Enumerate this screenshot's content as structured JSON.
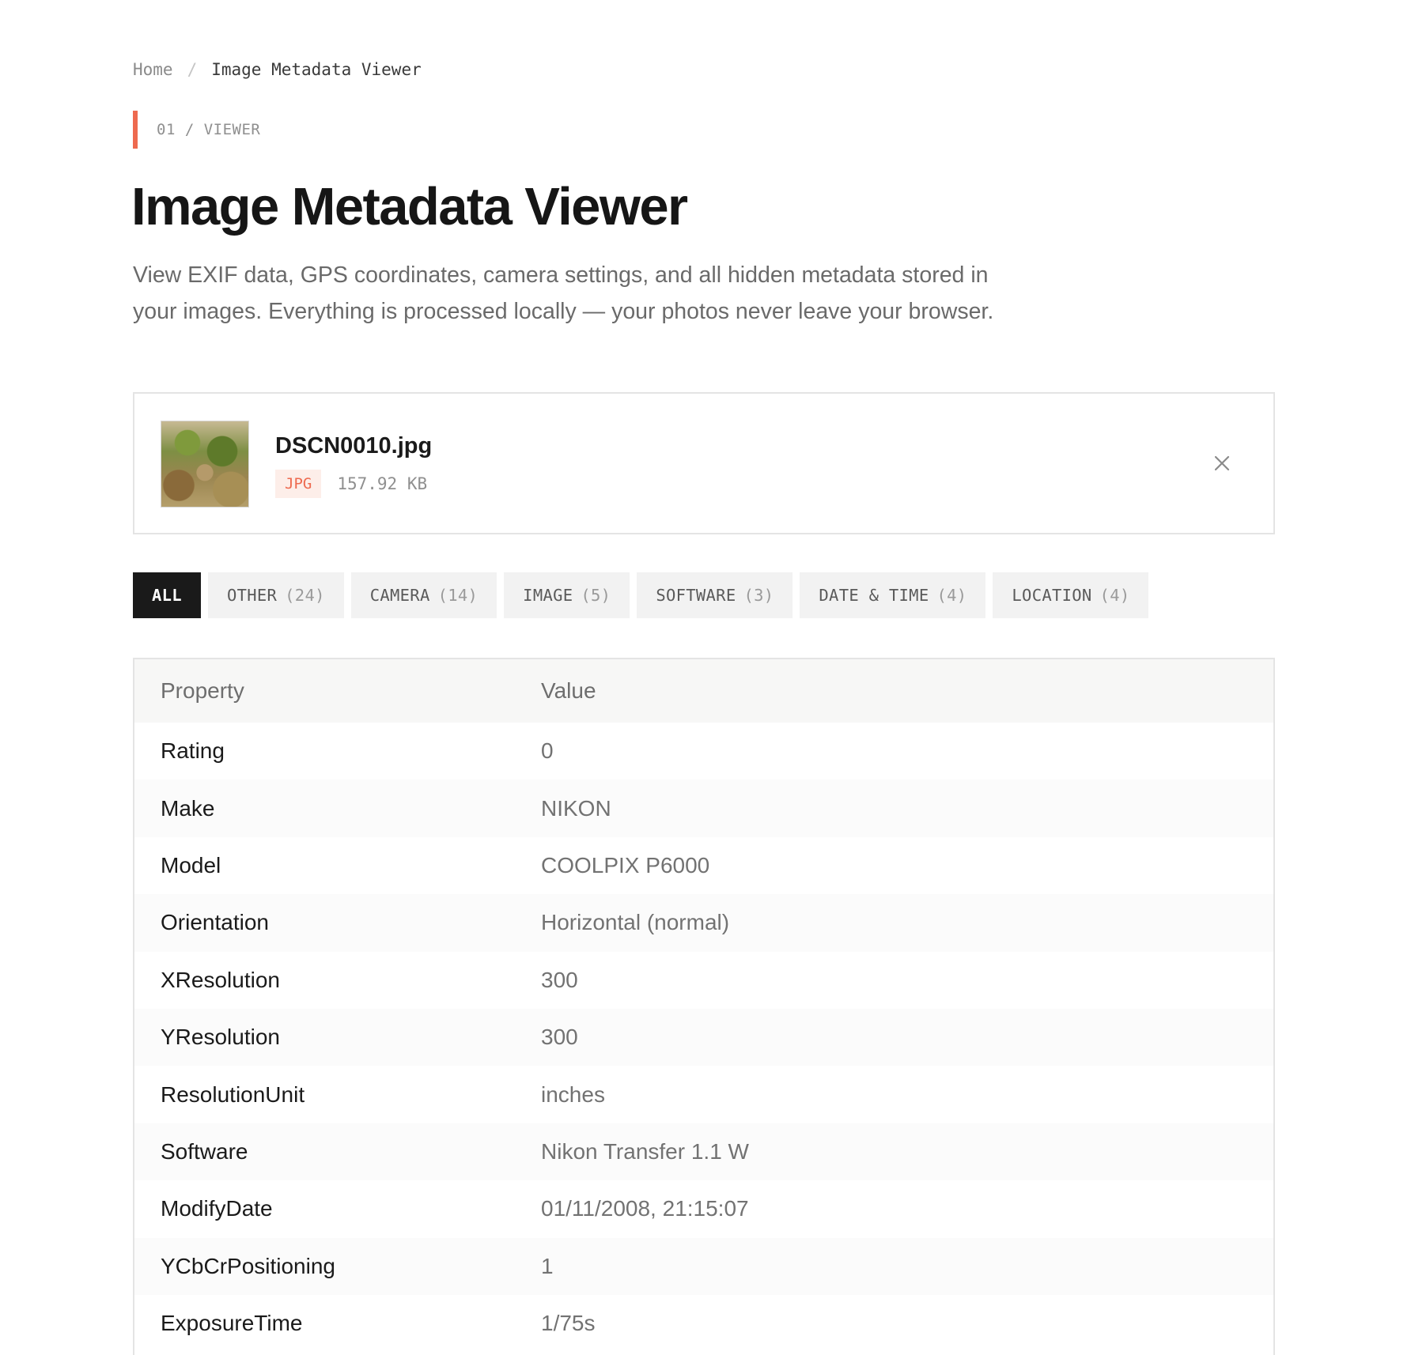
{
  "breadcrumb": {
    "home": "Home",
    "separator": "/",
    "current": "Image Metadata Viewer"
  },
  "eyebrow": "01 / VIEWER",
  "title": "Image Metadata Viewer",
  "description": "View EXIF data, GPS coordinates, camera settings, and all hidden metadata stored in your images. Everything is processed locally — your photos never leave your browser.",
  "file": {
    "name": "DSCN0010.jpg",
    "type_badge": "JPG",
    "size": "157.92 KB",
    "close_icon": "close-icon"
  },
  "tabs": [
    {
      "label": "ALL",
      "count": ""
    },
    {
      "label": "OTHER",
      "count": "(24)"
    },
    {
      "label": "CAMERA",
      "count": "(14)"
    },
    {
      "label": "IMAGE",
      "count": "(5)"
    },
    {
      "label": "SOFTWARE",
      "count": "(3)"
    },
    {
      "label": "DATE & TIME",
      "count": "(4)"
    },
    {
      "label": "LOCATION",
      "count": "(4)"
    }
  ],
  "table": {
    "headers": {
      "property": "Property",
      "value": "Value"
    },
    "rows": [
      {
        "property": "Rating",
        "value": "0"
      },
      {
        "property": "Make",
        "value": "NIKON"
      },
      {
        "property": "Model",
        "value": "COOLPIX P6000"
      },
      {
        "property": "Orientation",
        "value": "Horizontal (normal)"
      },
      {
        "property": "XResolution",
        "value": "300"
      },
      {
        "property": "YResolution",
        "value": "300"
      },
      {
        "property": "ResolutionUnit",
        "value": "inches"
      },
      {
        "property": "Software",
        "value": "Nikon Transfer 1.1 W"
      },
      {
        "property": "ModifyDate",
        "value": "01/11/2008, 21:15:07"
      },
      {
        "property": "YCbCrPositioning",
        "value": "1"
      },
      {
        "property": "ExposureTime",
        "value": "1/75s"
      }
    ]
  },
  "colors": {
    "accent": "#ee6a4f",
    "active_tab_bg": "#1a1a1a",
    "tab_bg": "#f2f2f2",
    "badge_bg": "#fdeee9"
  }
}
